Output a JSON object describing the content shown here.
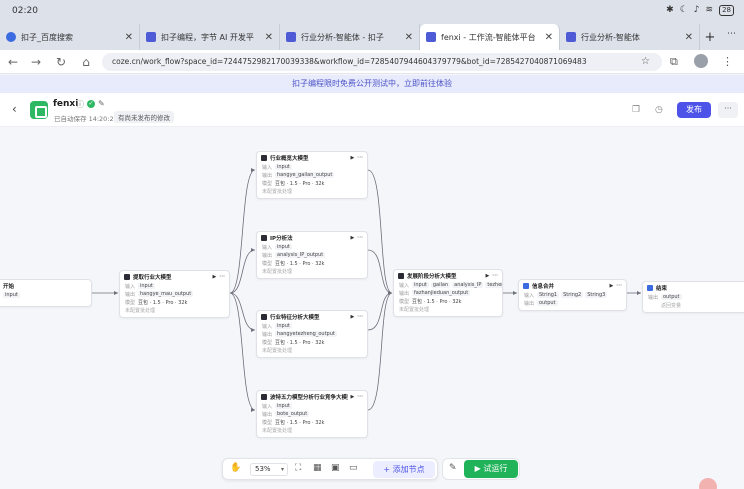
{
  "status_bar": {
    "time": "02:20",
    "battery": "28"
  },
  "tabs": [
    {
      "label": "扣子_百度搜索",
      "favicon": "baidu"
    },
    {
      "label": "扣子编程，字节 AI 开发平",
      "favicon": "coze"
    },
    {
      "label": "行业分析-智能体 - 扣子",
      "favicon": "coze"
    },
    {
      "label": "fenxi - 工作流-智能体平台",
      "favicon": "coze",
      "active": true
    },
    {
      "label": "行业分析-智能体",
      "favicon": "coze"
    }
  ],
  "address": {
    "url": "coze.cn/work_flow?space_id=7244752982170039338&workflow_id=7285407944604379779&bot_id=7285427040871069483"
  },
  "banner": {
    "text": "扣子编程限时免费公开测试中，立即前往体验"
  },
  "header": {
    "name": "fenxi",
    "saved": "已自动保存 14:20:25",
    "unpublished": "有尚未发布的修改",
    "publish_label": "发布",
    "more_label": "···"
  },
  "nodes": {
    "start": {
      "title": "开始",
      "rows": [
        {
          "key": "",
          "vals": [
            "input"
          ]
        }
      ]
    },
    "llm1": {
      "title": "提取行业大模型",
      "rows": [
        {
          "key": "输入",
          "vals": [
            "input"
          ]
        },
        {
          "key": "输出",
          "vals": [
            "hangye_mau_output"
          ]
        },
        {
          "key": "模型",
          "model": "豆包 · 1.5 · Pro · 32k"
        },
        {
          "key": "",
          "batch": "未配置批处理"
        }
      ]
    },
    "llm2": {
      "title": "行业概览大模型",
      "rows": [
        {
          "key": "输入",
          "vals": [
            "input"
          ]
        },
        {
          "key": "输出",
          "vals": [
            "hangye_gailan_output"
          ]
        },
        {
          "key": "模型",
          "model": "豆包 · 1.5 · Pro · 32k"
        },
        {
          "key": "",
          "batch": "未配置批处理"
        }
      ]
    },
    "llm3": {
      "title": "IP分析法",
      "rows": [
        {
          "key": "输入",
          "vals": [
            "input"
          ]
        },
        {
          "key": "输出",
          "vals": [
            "analysis_IP_output"
          ]
        },
        {
          "key": "模型",
          "model": "豆包 · 1.5 · Pro · 32k"
        },
        {
          "key": "",
          "batch": "未配置批处理"
        }
      ]
    },
    "llm4": {
      "title": "行业特征分析大模型",
      "rows": [
        {
          "key": "输入",
          "vals": [
            "input"
          ]
        },
        {
          "key": "输出",
          "vals": [
            "hangyetezheng_output"
          ]
        },
        {
          "key": "模型",
          "model": "豆包 · 1.5 · Pro · 32k"
        },
        {
          "key": "",
          "batch": "未配置批处理"
        }
      ]
    },
    "llm5": {
      "title": "波特五力模型分析行业竞争大模型",
      "rows": [
        {
          "key": "输入",
          "vals": [
            "input"
          ]
        },
        {
          "key": "输出",
          "vals": [
            "bote_output"
          ]
        },
        {
          "key": "模型",
          "model": "豆包 · 1.5 · Pro · 32k"
        },
        {
          "key": "",
          "batch": "未配置批处理"
        }
      ]
    },
    "llm6": {
      "title": "发展阶段分析大模型",
      "rows": [
        {
          "key": "输入",
          "vals": [
            "input",
            "gailan",
            "analysis_IP",
            "tezheng"
          ]
        },
        {
          "key": "输出",
          "vals": [
            "fazhanjieduan_output"
          ]
        },
        {
          "key": "模型",
          "model": "豆包 · 1.5 · Pro · 32k"
        },
        {
          "key": "",
          "batch": "未配置批处理"
        }
      ]
    },
    "merge": {
      "title": "信息合并",
      "rows": [
        {
          "key": "输入",
          "vals": [
            "String1",
            "String2",
            "String3"
          ]
        },
        {
          "key": "输出",
          "vals": [
            "output"
          ]
        }
      ]
    },
    "end": {
      "title": "结束",
      "rows": [
        {
          "key": "输出",
          "vals": [
            "output"
          ]
        },
        {
          "key": "",
          "batch": "返回变量"
        }
      ]
    }
  },
  "toolbar": {
    "zoom": "53%",
    "add_node_label": "+ 添加节点",
    "run_label": "▶ 试运行"
  },
  "colors": {
    "accent": "#4d53e8",
    "run": "#20b35a",
    "brand_logo": "#2fb863"
  }
}
